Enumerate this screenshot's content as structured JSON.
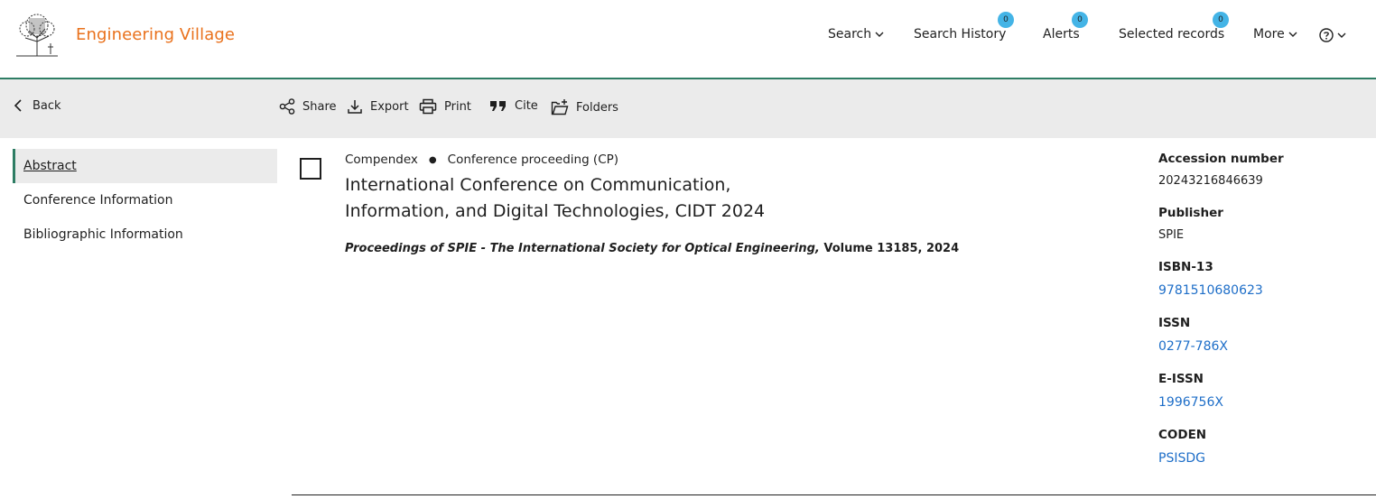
{
  "header": {
    "brand": "Engineering Village",
    "nav": {
      "search": "Search",
      "search_history": "Search History",
      "search_history_count": "0",
      "alerts": "Alerts",
      "alerts_count": "0",
      "selected_records": "Selected records",
      "selected_records_count": "0",
      "more": "More"
    }
  },
  "toolbar": {
    "back": "Back",
    "share": "Share",
    "export": "Export",
    "print": "Print",
    "cite": "Cite",
    "folders": "Folders"
  },
  "sidebar": {
    "items": [
      {
        "label": "Abstract",
        "active": true
      },
      {
        "label": "Conference Information",
        "active": false
      },
      {
        "label": "Bibliographic Information",
        "active": false
      }
    ]
  },
  "record": {
    "database": "Compendex",
    "doc_type": "Conference proceeding (CP)",
    "title_line1": "International Conference on Communication,",
    "title_line2": "Information, and Digital Technologies, CIDT 2024",
    "source_title": "Proceedings of SPIE - The International Society for Optical Engineering,",
    "source_rest": " Volume 13185, 2024"
  },
  "details": {
    "accession_label": "Accession number",
    "accession_value": "20243216846639",
    "publisher_label": "Publisher",
    "publisher_value": "SPIE",
    "isbn_label": "ISBN-13",
    "isbn_value": "9781510680623",
    "issn_label": "ISSN",
    "issn_value": "0277-786X",
    "eissn_label": "E-ISSN",
    "eissn_value": "1996756X",
    "coden_label": "CODEN",
    "coden_value": "PSISDG"
  },
  "colors": {
    "brand": "#e9711c",
    "accent": "#2e7d64",
    "badge": "#44b4e6",
    "link": "#1e6ec8",
    "toolbar_bg": "#ebebeb"
  }
}
